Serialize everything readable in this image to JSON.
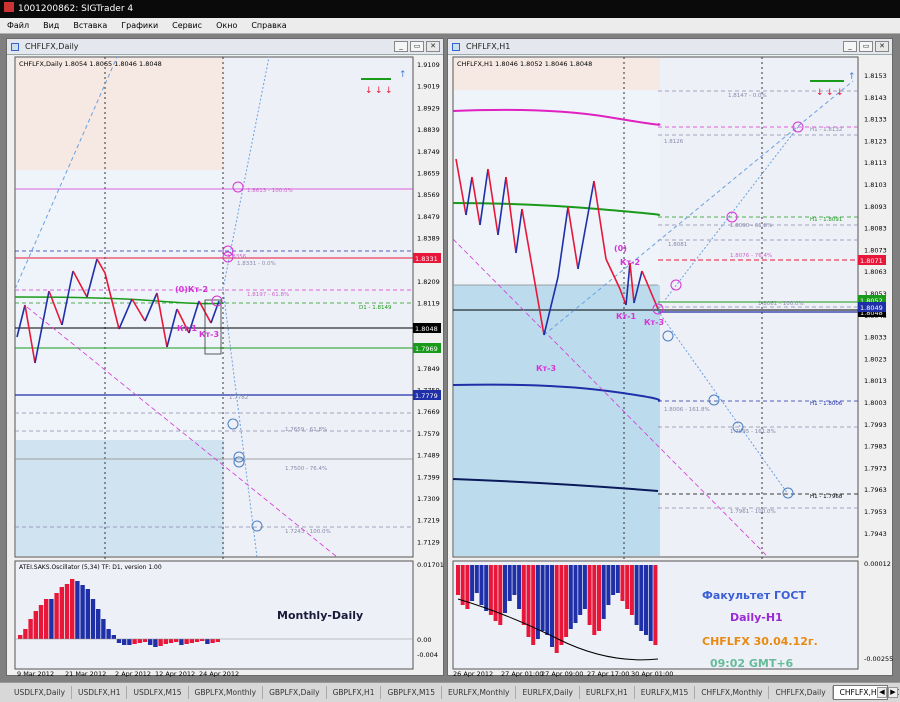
{
  "app": {
    "title": "1001200862: SIGTrader 4"
  },
  "menu": [
    "Файл",
    "Вид",
    "Вставка",
    "Графики",
    "Сервис",
    "Окно",
    "Справка"
  ],
  "left": {
    "window_title": "CHFLFX,Daily",
    "chart_header": "CHFLFX,Daily  1.8054 1.8065 1.8046 1.8048",
    "price_axis": [
      "1.9109",
      "1.9019",
      "1.8929",
      "1.8839",
      "1.8749",
      "1.8659",
      "1.8569",
      "1.8479",
      "1.8389",
      "1.8299",
      "1.8209",
      "1.8119",
      "1.8029",
      "1.7939",
      "1.7849",
      "1.7759",
      "1.7669",
      "1.7579",
      "1.7489",
      "1.7399",
      "1.7309",
      "1.7219",
      "1.7129"
    ],
    "price_tags": [
      {
        "text": "1.8331",
        "color": "#e8173a"
      },
      {
        "text": "1.8048",
        "color": "#000000"
      },
      {
        "text": "1.7969",
        "color": "#1a9a1a"
      },
      {
        "text": "1.7779",
        "color": "#1f2fa8"
      }
    ],
    "level_labels": [
      "1.8613 - 100.0%",
      "1.8331 - 0.0%",
      "1.8356",
      "1.8197 - 61.8%",
      "D1 - 1.8149",
      "1.7782",
      "1.7659 - 61.8%",
      "1.7500 - 76.4%",
      "1.7243 - 100.0%"
    ],
    "annotations": [
      "(0)Кт-2",
      "Кт-1",
      "Кт-3"
    ],
    "osc_header": "ATEI.SAKS.Oscillator (5,34) TF: D1, version 1.00",
    "osc_axis": [
      "0.01701",
      "0.00",
      "-0.004"
    ],
    "osc_label": "Monthly-Daily",
    "time_axis": [
      "9 Mar 2012",
      "21 Mar 2012",
      "2 Apr 2012",
      "12 Apr 2012",
      "24 Apr 2012"
    ]
  },
  "right": {
    "window_title": "CHFLFX,H1",
    "chart_header": "CHFLFX,H1  1.8046 1.8052 1.8046 1.8048",
    "price_axis": [
      "1.8153",
      "1.8143",
      "1.8133",
      "1.8123",
      "1.8113",
      "1.8103",
      "1.8093",
      "1.8083",
      "1.8073",
      "1.8063",
      "1.8053",
      "1.8043",
      "1.8033",
      "1.8023",
      "1.8013",
      "1.8003",
      "1.7993",
      "1.7983",
      "1.7973",
      "1.7963",
      "1.7953",
      "1.7943"
    ],
    "price_tags": [
      {
        "text": "1.8071",
        "color": "#e8173a"
      },
      {
        "text": "1.8052",
        "color": "#1a9a1a"
      },
      {
        "text": "1.8048",
        "color": "#000000"
      },
      {
        "text": "1.8049",
        "color": "#1f2fa8"
      }
    ],
    "level_labels": [
      "1.8147 - 0.0%",
      "H1 - 1.8132",
      "1.8126",
      "H1 - 1.8091",
      "1.8090 - 61.8%",
      "1.8081",
      "1.8076 - 76.4%",
      "1.8061 - 100.0%",
      "1.8006 - 161.8%",
      "H1 - 1.8006",
      "1.7995 - 161.8%",
      "H1 - 1.7968",
      "1.7961 - 100.0%"
    ],
    "annotations": [
      "(0)",
      "Кт-2",
      "Кт-1",
      "Кт-3",
      "Кт-3"
    ],
    "osc_axis": [
      "0.00012",
      "-0.00255"
    ],
    "info": [
      "Факультет ГОСТ",
      "Daily-H1",
      "CHFLFX  30.04.12г.",
      "09:02 GMT+6"
    ],
    "time_axis": [
      "26 Apr 2012",
      "27 Apr 01:00",
      "27 Apr 09:00",
      "27 Apr 17:00",
      "30 Apr 01:00"
    ]
  },
  "tabs": [
    "USDLFX,Daily",
    "USDLFX,H1",
    "USDLFX,M15",
    "GBPLFX,Monthly",
    "GBPLFX,Daily",
    "GBPLFX,H1",
    "GBPLFX,M15",
    "EURLFX,Monthly",
    "EURLFX,Daily",
    "EURLFX,H1",
    "EURLFX,M15",
    "CHFLFX,Monthly",
    "CHFLFX,Daily",
    "CHFLFX,H1",
    "CHFL"
  ],
  "active_tab": "CHFLFX,H1",
  "colors": {
    "bull": "#e8173a",
    "bear": "#1f2fa8",
    "fib": "#d633d6",
    "ma": "#1a9a1a",
    "info_blue": "#3a5fd6",
    "info_purple": "#9a2ad6",
    "info_orange": "#e88a10",
    "info_teal": "#66bb99"
  }
}
